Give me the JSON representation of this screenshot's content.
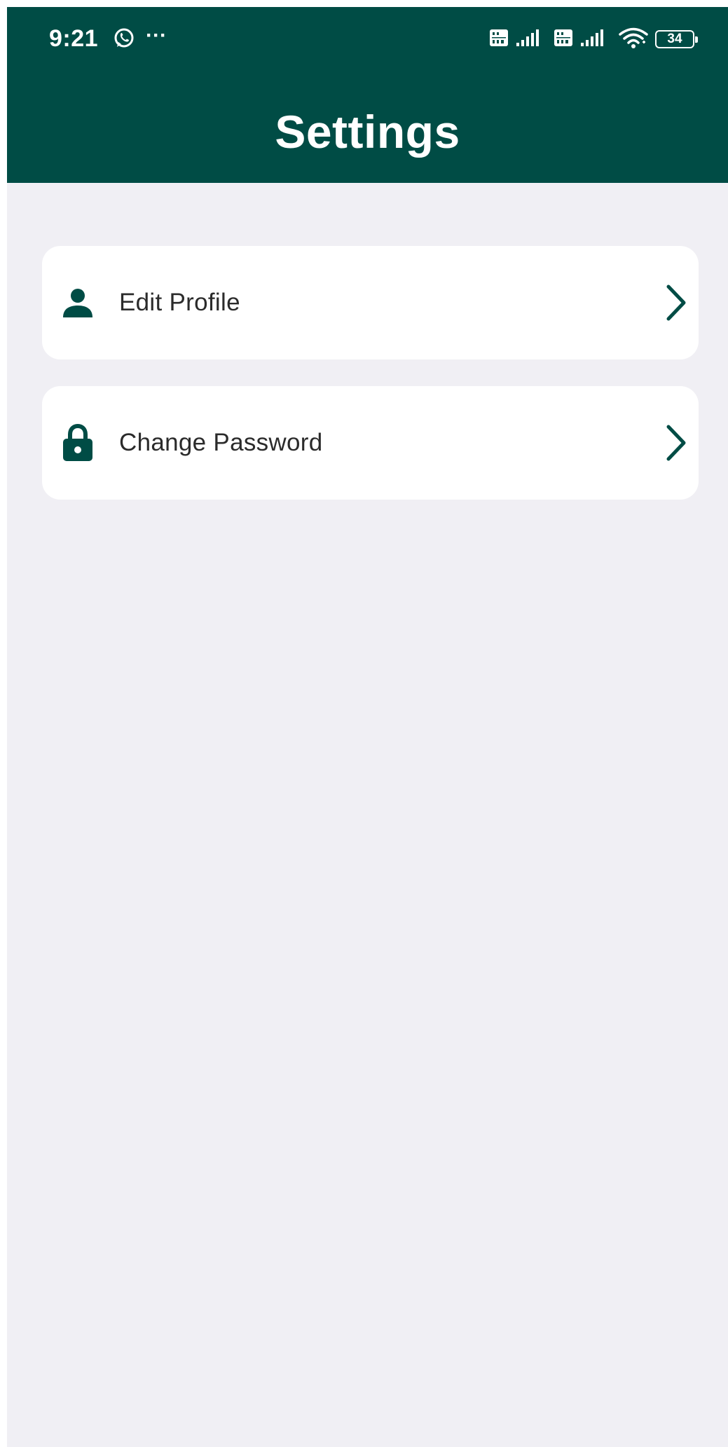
{
  "status_bar": {
    "time": "9:21",
    "battery": "34",
    "icons": [
      "whatsapp-icon",
      "more-dots-icon",
      "volte-icon",
      "signal-icon",
      "volte-icon",
      "signal-icon",
      "wifi-icon",
      "battery-icon"
    ]
  },
  "header": {
    "title": "Settings"
  },
  "settings": {
    "items": [
      {
        "label": "Edit Profile",
        "icon": "person-icon"
      },
      {
        "label": "Change Password",
        "icon": "lock-icon"
      }
    ]
  },
  "colors": {
    "brand": "#004c45",
    "background": "#f0eff4",
    "card": "#ffffff",
    "text": "#2b2b2b"
  }
}
